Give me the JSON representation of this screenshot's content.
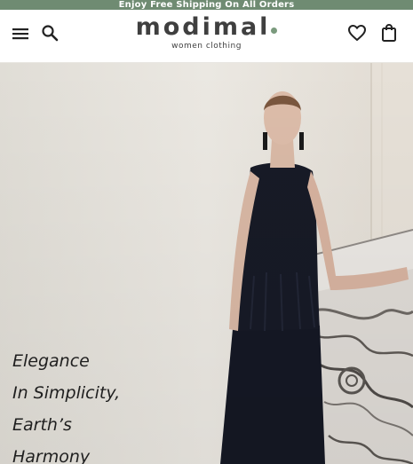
{
  "promo": {
    "text": "Enjoy Free Shipping On All Orders",
    "color": "#6f8b72"
  },
  "header": {
    "logo_text": "modimal",
    "logo_tagline": "women clothing",
    "icons": [
      "menu-icon",
      "search-icon",
      "heart-icon",
      "shopping-bag-icon"
    ]
  },
  "hero": {
    "headline_lines": [
      "Elegance",
      "In Simplicity,",
      "Earth’s",
      "Harmony"
    ]
  }
}
